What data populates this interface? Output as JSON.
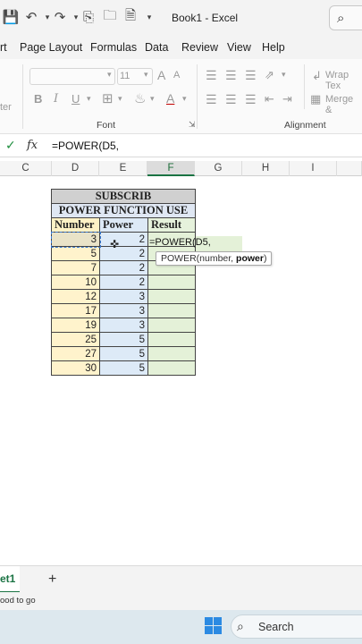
{
  "window": {
    "title": "Book1  -  Excel"
  },
  "menu": [
    "rt",
    "Page Layout",
    "Formulas",
    "Data",
    "Review",
    "View",
    "Help"
  ],
  "ribbon": {
    "font_group_label": "Font",
    "font_size": "11",
    "alignment_group_label": "Alignment",
    "wrap_text": "Wrap Tex",
    "merge": "Merge &",
    "bold": "B",
    "italic": "I",
    "underline": "U",
    "grow_font": "A",
    "shrink_font": "A",
    "font_color": "A",
    "left_stub": "ter"
  },
  "formula_bar": {
    "fx": "fx",
    "formula": "=POWER(D5,"
  },
  "columns": [
    "C",
    "D",
    "E",
    "F",
    "G",
    "H",
    "I"
  ],
  "table": {
    "title": "SUBSCRIB",
    "subtitle": "POWER FUNCTION USE",
    "headers": [
      "Number",
      "Power",
      "Result"
    ],
    "rows": [
      {
        "number": "3",
        "power": "2"
      },
      {
        "number": "5",
        "power": "2"
      },
      {
        "number": "7",
        "power": "2"
      },
      {
        "number": "10",
        "power": "2"
      },
      {
        "number": "12",
        "power": "3"
      },
      {
        "number": "17",
        "power": "3"
      },
      {
        "number": "19",
        "power": "3"
      },
      {
        "number": "25",
        "power": "5"
      },
      {
        "number": "27",
        "power": "5"
      },
      {
        "number": "30",
        "power": "5"
      }
    ]
  },
  "edit_cell": "=POWER(D5,",
  "tooltip": {
    "text": "POWER(number, ",
    "bold": "power",
    "end": ")"
  },
  "sheet": {
    "tab": "et1",
    "add": "+"
  },
  "status": "ood to go",
  "taskbar": {
    "search": "Search"
  }
}
